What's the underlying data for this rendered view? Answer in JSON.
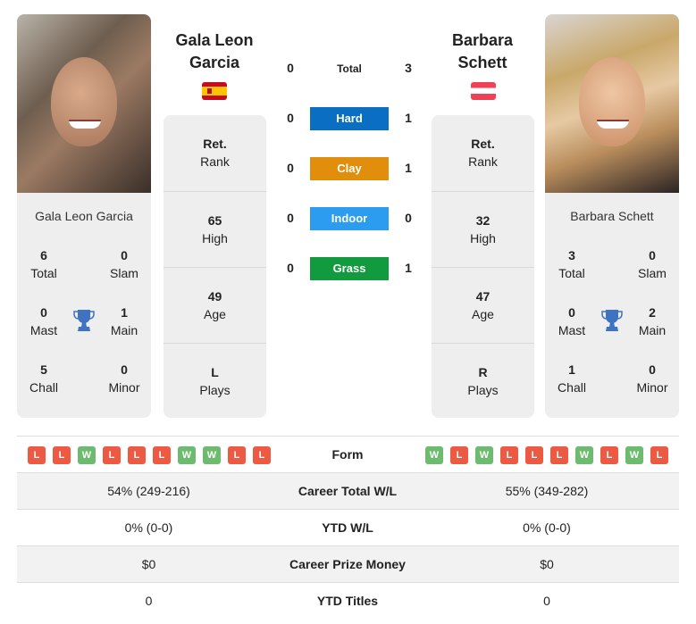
{
  "player1": {
    "name": "Gala Leon Garcia",
    "name_line1": "Gala Leon",
    "name_line2": "Garcia",
    "flag": "spain-flag",
    "titles": {
      "total": "6",
      "slam": "0",
      "mast": "0",
      "main": "1",
      "chall": "5",
      "minor": "0"
    },
    "rank": {
      "value": "Ret.",
      "label": "Rank"
    },
    "high": {
      "value": "65",
      "label": "High"
    },
    "age": {
      "value": "49",
      "label": "Age"
    },
    "plays": {
      "value": "L",
      "label": "Plays"
    },
    "form": [
      "L",
      "L",
      "W",
      "L",
      "L",
      "L",
      "W",
      "W",
      "L",
      "L"
    ],
    "career_wl": "54% (249-216)",
    "ytd_wl": "0% (0-0)",
    "prize": "$0",
    "ytd_titles": "0"
  },
  "player2": {
    "name": "Barbara Schett",
    "name_line1": "Barbara",
    "name_line2": "Schett",
    "flag": "austria-flag",
    "titles": {
      "total": "3",
      "slam": "0",
      "mast": "0",
      "main": "2",
      "chall": "1",
      "minor": "0"
    },
    "rank": {
      "value": "Ret.",
      "label": "Rank"
    },
    "high": {
      "value": "32",
      "label": "High"
    },
    "age": {
      "value": "47",
      "label": "Age"
    },
    "plays": {
      "value": "R",
      "label": "Plays"
    },
    "form": [
      "W",
      "L",
      "W",
      "L",
      "L",
      "L",
      "W",
      "L",
      "W",
      "L"
    ],
    "career_wl": "55% (349-282)",
    "ytd_wl": "0% (0-0)",
    "prize": "$0",
    "ytd_titles": "0"
  },
  "title_labels": {
    "total": "Total",
    "slam": "Slam",
    "mast": "Mast",
    "main": "Main",
    "chall": "Chall",
    "minor": "Minor"
  },
  "h2h": [
    {
      "label": "Total",
      "p1": "0",
      "p2": "3",
      "color": ""
    },
    {
      "label": "Hard",
      "p1": "0",
      "p2": "1",
      "color": "#0a6fc2"
    },
    {
      "label": "Clay",
      "p1": "0",
      "p2": "1",
      "color": "#e08e0b"
    },
    {
      "label": "Indoor",
      "p1": "0",
      "p2": "0",
      "color": "#2b9cf0"
    },
    {
      "label": "Grass",
      "p1": "0",
      "p2": "1",
      "color": "#129a3f"
    }
  ],
  "table_labels": {
    "form": "Form",
    "career_wl": "Career Total W/L",
    "ytd_wl": "YTD W/L",
    "prize": "Career Prize Money",
    "ytd_titles": "YTD Titles"
  }
}
